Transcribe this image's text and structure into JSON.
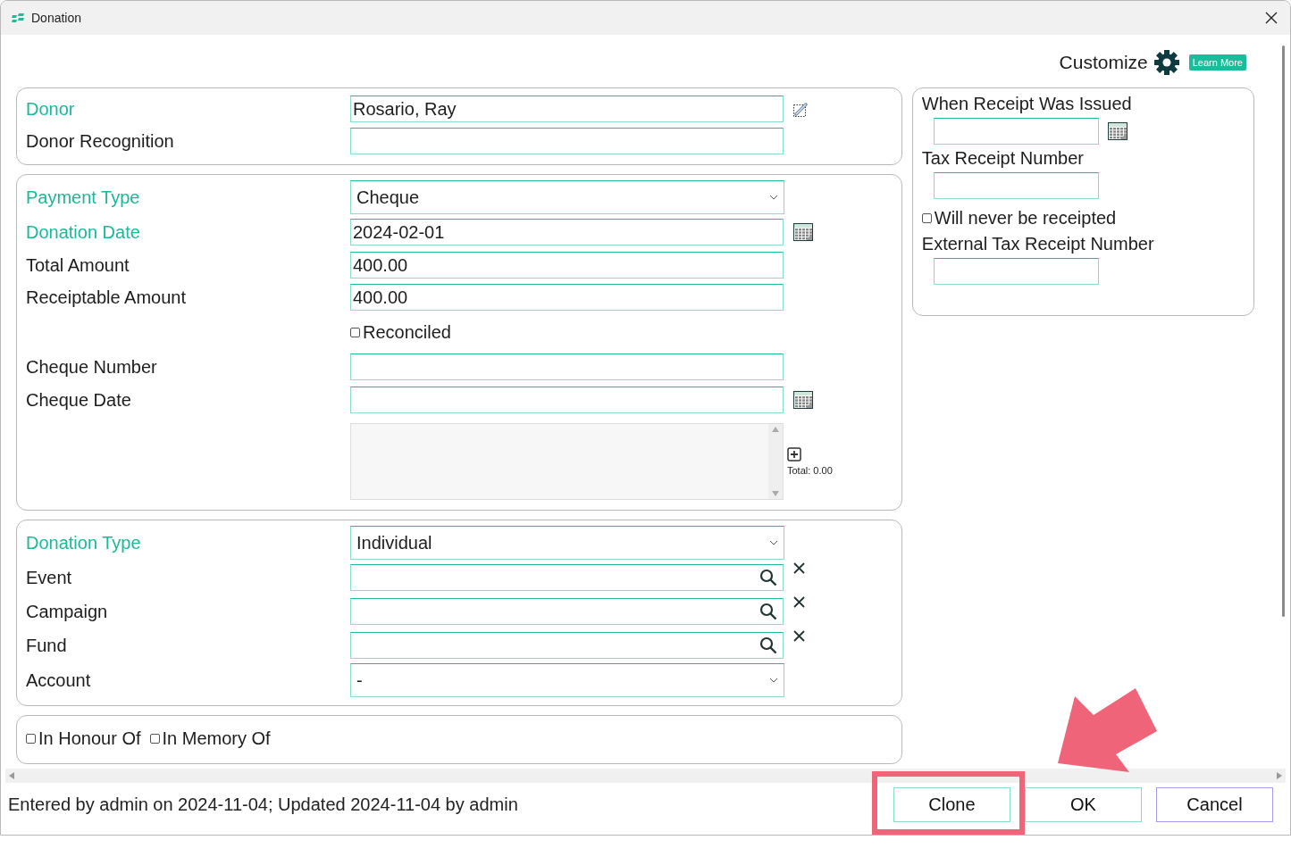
{
  "window": {
    "title": "Donation"
  },
  "customize": {
    "label": "Customize",
    "link": "Learn More"
  },
  "sections": [
    {
      "rows": [
        {
          "kind": "text",
          "label": "Donor",
          "required": true,
          "value": "Rosario, Ray",
          "link_icon": true
        },
        {
          "kind": "text",
          "label": "Donor Recognition",
          "required": false
        }
      ]
    },
    {
      "rows": [
        {
          "kind": "select",
          "label": "Payment Type",
          "required": true,
          "value": "Cheque"
        },
        {
          "kind": "date",
          "label": "Donation Date",
          "required": true,
          "value": "2024-02-01"
        },
        {
          "kind": "text",
          "label": "Total Amount",
          "required": false,
          "value": "400.00"
        },
        {
          "kind": "text",
          "label": "Receiptable Amount",
          "required": false,
          "value": "400.00"
        },
        {
          "kind": "checkbox",
          "label": "Reconciled",
          "checked": false
        },
        {
          "kind": "text",
          "label": "Cheque Number",
          "required": false
        },
        {
          "kind": "date",
          "label": "Cheque Date",
          "required": false
        },
        {
          "kind": "list",
          "total": "Total: 0.00"
        }
      ]
    },
    {
      "rows": [
        {
          "kind": "select",
          "label": "Donation Type",
          "required": true,
          "value": "Individual"
        },
        {
          "kind": "lookup",
          "label": "Event",
          "required": false
        },
        {
          "kind": "lookup",
          "label": "Campaign",
          "required": false
        },
        {
          "kind": "lookup",
          "label": "Fund",
          "required": false
        },
        {
          "kind": "select",
          "label": "Account",
          "required": false,
          "value": "-"
        }
      ]
    },
    {
      "rows": [
        {
          "kind": "checkboxes",
          "items": [
            {
              "label": "In Honour Of",
              "checked": false
            },
            {
              "label": "In Memory Of",
              "checked": false
            }
          ]
        }
      ]
    }
  ],
  "receipt_panel": {
    "rows": [
      {
        "kind": "date",
        "label": "When Receipt Was Issued"
      },
      {
        "kind": "text",
        "label": "Tax Receipt Number"
      },
      {
        "kind": "checkbox",
        "label": "Will never be receipted",
        "checked": false
      },
      {
        "kind": "text",
        "label": "External Tax Receipt Number"
      }
    ]
  },
  "status": "Entered by admin on 2024-11-04; Updated 2024-11-04 by admin",
  "buttons": [
    {
      "label": "Clone",
      "highlighted": true,
      "focused": false
    },
    {
      "label": "OK",
      "highlighted": false,
      "focused": false
    },
    {
      "label": "Cancel",
      "highlighted": false,
      "focused": true
    }
  ]
}
